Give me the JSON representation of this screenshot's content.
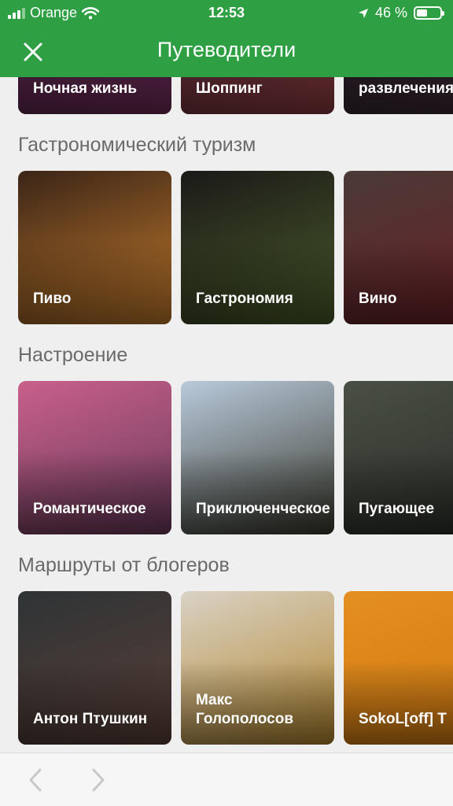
{
  "status": {
    "carrier": "Orange",
    "time": "12:53",
    "battery": "46 %",
    "battery_level": 0.46
  },
  "header": {
    "title": "Путеводители"
  },
  "top_row": {
    "cards": [
      {
        "label": "Ночная жизнь",
        "colors": [
          "#3a1f3a",
          "#6d2a55"
        ]
      },
      {
        "label": "Шоппинг",
        "colors": [
          "#3b2430",
          "#8a3a3f"
        ]
      },
      {
        "label": "развлечения",
        "colors": [
          "#1e1a22",
          "#3d2a35"
        ]
      }
    ]
  },
  "sections": [
    {
      "title": "Гастрономический туризм",
      "cards": [
        {
          "label": "Пиво",
          "colors": [
            "#3b2517",
            "#c27a2c"
          ]
        },
        {
          "label": "Гастрономия",
          "colors": [
            "#1b1a18",
            "#4a5a2a"
          ]
        },
        {
          "label": "Вино",
          "colors": [
            "#4a3a38",
            "#6b1f24"
          ]
        }
      ]
    },
    {
      "title": "Настроение",
      "cards": [
        {
          "label": "Романтическое",
          "colors": [
            "#c8608a",
            "#6a3a5a"
          ]
        },
        {
          "label": "Приключенческое",
          "colors": [
            "#b9cadb",
            "#3a3a2e"
          ]
        },
        {
          "label": "Пугающее",
          "colors": [
            "#4a4f44",
            "#2a2e28"
          ]
        }
      ]
    },
    {
      "title": "Маршруты от блогеров",
      "cards": [
        {
          "label": "Антон Птушкин",
          "colors": [
            "#2e3335",
            "#5a4038"
          ]
        },
        {
          "label": "Макс\nГолополосов",
          "colors": [
            "#d9d2c5",
            "#b3862e"
          ]
        },
        {
          "label": "SokoL[off] T",
          "colors": [
            "#e48f22",
            "#d27a10"
          ]
        }
      ]
    }
  ]
}
